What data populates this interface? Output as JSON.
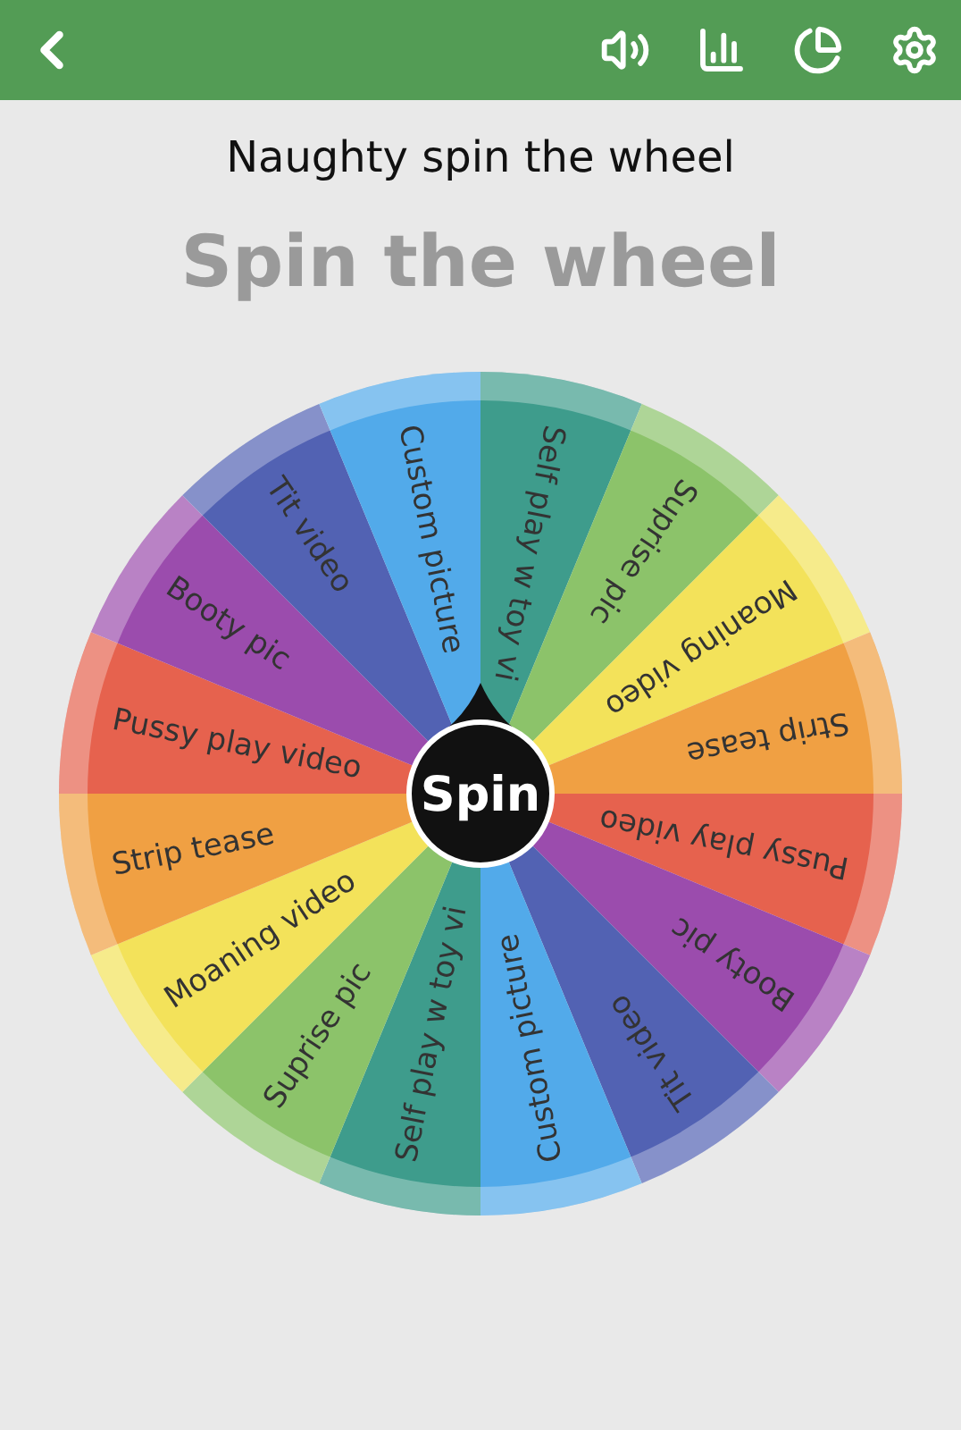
{
  "subtitle": "Naughty spin the wheel",
  "title": "Spin the wheel",
  "wheel": {
    "spin_label": "Spin",
    "segments": [
      {
        "label": "Self play w toy vi",
        "color": "#3e9c8c"
      },
      {
        "label": "Suprise pic",
        "color": "#8cc36a"
      },
      {
        "label": "Moaning video",
        "color": "#f3e25a"
      },
      {
        "label": "Strip tease",
        "color": "#f0a043"
      },
      {
        "label": "Pussy play video",
        "color": "#e6624e"
      },
      {
        "label": "Booty pic",
        "color": "#9b4cad"
      },
      {
        "label": "Tit video",
        "color": "#5262b3"
      },
      {
        "label": "Custom picture",
        "color": "#52aaea"
      },
      {
        "label": "Self play w toy vi",
        "color": "#3e9c8c"
      },
      {
        "label": "Suprise pic",
        "color": "#8cc36a"
      },
      {
        "label": "Moaning video",
        "color": "#f3e25a"
      },
      {
        "label": "Strip tease",
        "color": "#f0a043"
      },
      {
        "label": "Pussy play video",
        "color": "#e6624e"
      },
      {
        "label": "Booty pic",
        "color": "#9b4cad"
      },
      {
        "label": "Tit video",
        "color": "#5262b3"
      },
      {
        "label": "Custom picture",
        "color": "#52aaea"
      }
    ]
  }
}
